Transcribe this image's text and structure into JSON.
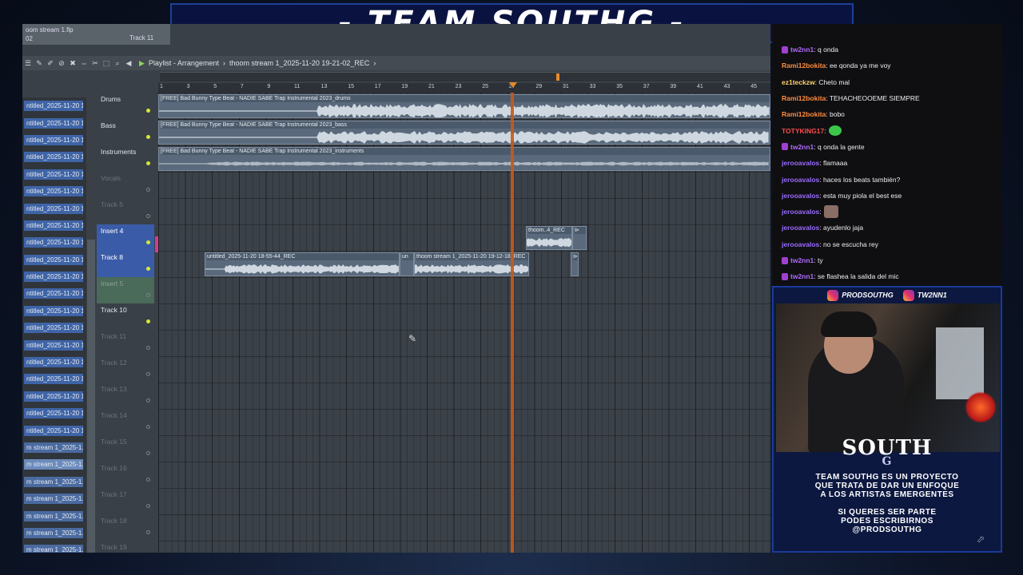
{
  "banner": {
    "title": "- TEAM SOUTHG -"
  },
  "daw": {
    "file_title": "oom stream 1.flp",
    "file_sub": "02",
    "track_label": "Track 11",
    "breadcrumb": [
      "Playlist - Arrangement",
      "thoom stream 1_2025-11-20 19-21-02_REC"
    ],
    "ruler": [
      "1",
      "3",
      "5",
      "7",
      "9",
      "11",
      "13",
      "15",
      "17",
      "19",
      "21",
      "23",
      "25",
      "27",
      "29",
      "31",
      "33",
      "35",
      "37",
      "39",
      "41",
      "43",
      "45"
    ],
    "browser_items": [
      "ntitled_2025-11-20 18-...",
      "ntitled_2025-11-20 18-...",
      "ntitled_2025-11-20 18-...",
      "ntitled_2025-11-20 18-...",
      "ntitled_2025-11-20 18-...",
      "ntitled_2025-11-20 18-...",
      "ntitled_2025-11-20 18-...",
      "ntitled_2025-11-20 18-...",
      "ntitled_2025-11-20 18-...",
      "ntitled_2025-11-20 18-...",
      "ntitled_2025-11-20 18-...",
      "ntitled_2025-11-20 19-...",
      "ntitled_2025-11-20 19-...",
      "ntitled_2025-11-20 19-...",
      "ntitled_2025-11-20 19-...",
      "ntitled_2025-11-20 19-...",
      "ntitled_2025-11-20 19-...",
      "ntitled_2025-11-20 19-...",
      "ntitled_2025-11-20 19-...",
      "ntitled_2025-11-20 19-...",
      "m stream 1_2025-1...",
      "m stream 1_2025-1...",
      "m stream 1_2025-1...",
      "m stream 1_2025-1...",
      "m stream 1_2025-1...",
      "m stream 1_2025-1...",
      "m stream 1_2025-1..."
    ],
    "tracks": [
      {
        "name": "Drums",
        "muted": false,
        "on": true
      },
      {
        "name": "Bass",
        "muted": false,
        "on": true
      },
      {
        "name": "Instruments",
        "muted": false,
        "on": true
      },
      {
        "name": "Vocals",
        "muted": true,
        "on": false
      },
      {
        "name": "Track 5",
        "muted": true,
        "on": false
      },
      {
        "name": "Insert 4",
        "muted": false,
        "on": true
      },
      {
        "name": "Track 8",
        "muted": false,
        "on": true
      },
      {
        "name": "Insert 5",
        "muted": true,
        "on": false
      },
      {
        "name": "Track 10",
        "muted": false,
        "on": true
      },
      {
        "name": "Track 11",
        "muted": true,
        "on": false
      },
      {
        "name": "Track 12",
        "muted": true,
        "on": false
      },
      {
        "name": "Track 13",
        "muted": true,
        "on": false
      },
      {
        "name": "Track 14",
        "muted": true,
        "on": false
      },
      {
        "name": "Track 15",
        "muted": true,
        "on": false
      },
      {
        "name": "Track 16",
        "muted": true,
        "on": false
      },
      {
        "name": "Track 17",
        "muted": true,
        "on": false
      },
      {
        "name": "Track 18",
        "muted": true,
        "on": false
      },
      {
        "name": "Track 19",
        "muted": true,
        "on": false
      }
    ],
    "clips": {
      "drums": "[FREE] Bad Bunny Type Beat - NADIE SABE  Trap Instrumental 2023_drums",
      "bass": "[FREE] Bad Bunny Type Beat - NADIE SABE  Trap Instrumental 2023_bass",
      "instruments": "[FREE] Bad Bunny Type Beat - NADIE SABE  Trap Instrumental 2023_instruments",
      "thoom4": "thoom..4_REC",
      "untitled": "untitled_2025-11-20 18-55-44_REC",
      "un": "un",
      "thoom_stream": "thoom stream 1_2025-11-20 19-12-18_REC"
    }
  },
  "chat": [
    {
      "user": "tw2nn1",
      "color": "#b26bff",
      "badge": true,
      "text": ": q onda"
    },
    {
      "user": "Rami12bokita",
      "color": "#ff8c3a",
      "badge": false,
      "text": ": ee qonda ya me voy"
    },
    {
      "user": "ez1teckzw",
      "color": "#ffd36b",
      "badge": false,
      "text": ": Cheto mal"
    },
    {
      "user": "Rami12bokita",
      "color": "#ff8c3a",
      "badge": false,
      "text": ": TEHACHEOOEME SIEMPRE"
    },
    {
      "user": "Rami12bokita",
      "color": "#ff8c3a",
      "badge": false,
      "text": ": bobo"
    },
    {
      "user": "TOTYKING17",
      "color": "#ff4a4a",
      "badge": false,
      "text": ":",
      "emote": "green"
    },
    {
      "user": "tw2nn1",
      "color": "#b26bff",
      "badge": true,
      "text": ": q onda la gente"
    },
    {
      "user": "jeroоavalos",
      "color": "#9a6bff",
      "badge": false,
      "text": ": flamaaa"
    },
    {
      "user": "jeroоavalos",
      "color": "#9a6bff",
      "badge": false,
      "text": ": haces los beats también?"
    },
    {
      "user": "jeroоavalos",
      "color": "#9a6bff",
      "badge": false,
      "text": ": esta muy piola el best ese"
    },
    {
      "user": "jeroоavalos",
      "color": "#9a6bff",
      "badge": false,
      "text": ":",
      "emote": "face"
    },
    {
      "user": "jeroоavalos",
      "color": "#9a6bff",
      "badge": false,
      "text": ": ayudenlo jaja"
    },
    {
      "user": "jeroоavalos",
      "color": "#9a6bff",
      "badge": false,
      "text": ": no se escucha rey"
    },
    {
      "user": "tw2nn1",
      "color": "#b26bff",
      "badge": true,
      "text": ": ty"
    },
    {
      "user": "tw2nn1",
      "color": "#b26bff",
      "badge": true,
      "text": ": se flashea la salida del mic"
    }
  ],
  "overlay": {
    "social1": "PRODSOUTHG",
    "social2": "TW2NN1",
    "logo": "SOUTH",
    "logo_sub": "G",
    "promo1": [
      "TEAM SOUTHG ES UN PROYECTO",
      "QUE TRATA DE DAR UN ENFOQUE",
      "A LOS ARTISTAS EMERGENTES"
    ],
    "promo2": [
      "SI QUERES SER PARTE",
      "PODES ESCRIBIRNOS",
      "@PRODSOUTHG"
    ]
  }
}
